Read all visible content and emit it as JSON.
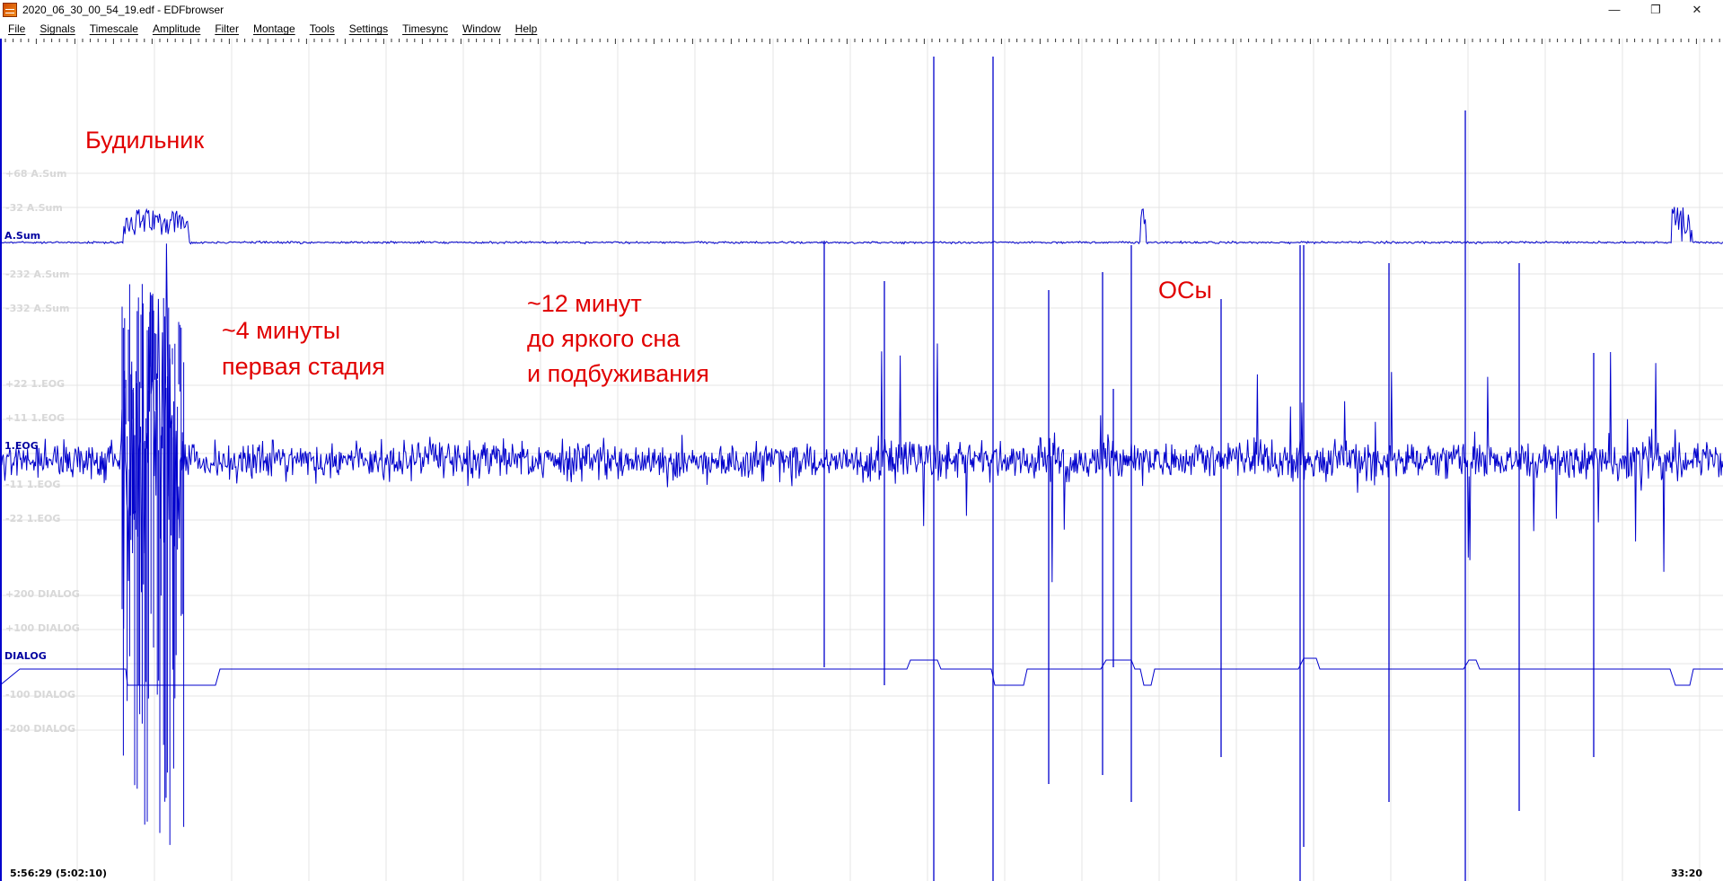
{
  "window": {
    "title": "2020_06_30_00_54_19.edf - EDFbrowser",
    "minimize_glyph": "—",
    "maximize_glyph": "❐",
    "close_glyph": "✕"
  },
  "menu": [
    {
      "label": "File"
    },
    {
      "label": "Signals"
    },
    {
      "label": "Timescale"
    },
    {
      "label": "Amplitude"
    },
    {
      "label": "Filter"
    },
    {
      "label": "Montage"
    },
    {
      "label": "Tools"
    },
    {
      "label": "Settings"
    },
    {
      "label": "Timesync"
    },
    {
      "label": "Window"
    },
    {
      "label": "Help"
    }
  ],
  "signals": [
    {
      "name": "A.Sum",
      "baseline": 2.0,
      "noise": 0.5,
      "color": "#0000cc"
    },
    {
      "name": "1.EOG",
      "baseline": 0,
      "noise": 1.0,
      "color": "#0000cc"
    },
    {
      "name": "DIALOG",
      "baseline": 0,
      "noise": 0.0,
      "color": "#0000cc"
    }
  ],
  "scale_labels": [
    {
      "text": "+68 A.Sum"
    },
    {
      "text": "-32 A.Sum"
    },
    {
      "text": "-232 A.Sum"
    },
    {
      "text": "-332 A.Sum"
    },
    {
      "text": "+22 1.EOG"
    },
    {
      "text": "+11 1.EOG"
    },
    {
      "text": "-11 1.EOG"
    },
    {
      "text": "-22 1.EOG"
    },
    {
      "text": "+200 DIALOG"
    },
    {
      "text": "+100 DIALOG"
    },
    {
      "text": "-100 DIALOG"
    },
    {
      "text": "-200 DIALOG"
    }
  ],
  "annotations": {
    "alarm": "Будильник",
    "stage_line1": "~4 минуты",
    "stage_line2": "первая стадия",
    "dream_line1": "~12 минут",
    "dream_line2": "до яркого сна",
    "dream_line3": "и подбуживания",
    "od": "ОСы"
  },
  "time": {
    "start": "5:56:29 (5:02:10)",
    "end": "33:20"
  },
  "colors": {
    "trace": "#0000cc",
    "annotation": "#e10000",
    "grid": "#e4e4e4"
  }
}
